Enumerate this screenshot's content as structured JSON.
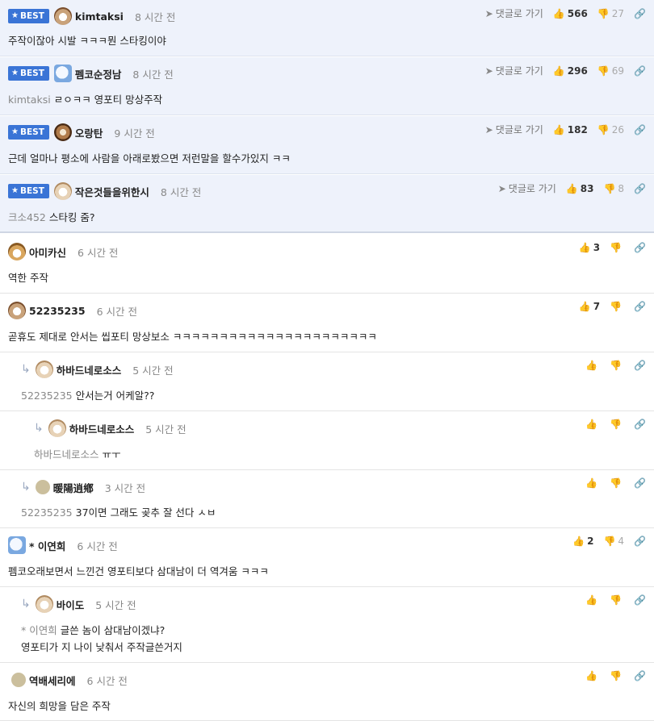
{
  "labels": {
    "best": "BEST",
    "goto_reply": "댓글로 가기"
  },
  "icons": {
    "star": "★",
    "plane": "➤",
    "thumb_up": "👍",
    "thumb_down": "👎",
    "link": "🔗",
    "reply_arrow": "↳"
  },
  "best_comments": [
    {
      "nick": "kimtaksi",
      "time": "8 시간 전",
      "text": "주작이잖아 시발 ㅋㅋㅋ뭔 스타킹이야",
      "mention": "",
      "up": "566",
      "down": "27"
    },
    {
      "nick": "펨코순정남",
      "time": "8 시간 전",
      "text": "ㄹㅇㅋㅋ 영포티 망상주작",
      "mention": "kimtaksi",
      "up": "296",
      "down": "69"
    },
    {
      "nick": "오랑탄",
      "time": "9 시간 전",
      "text": "근데 얼마나 평소에 사람을 아래로봤으면 저런말을 할수가있지 ㅋㅋ",
      "mention": "",
      "up": "182",
      "down": "26"
    },
    {
      "nick": "작은것들을위한시",
      "time": "8 시간 전",
      "text": "스타킹 줌?",
      "mention": "크소452",
      "up": "83",
      "down": "8"
    }
  ],
  "comments": [
    {
      "nick": "아미카신",
      "time": "6 시간 전",
      "text": "역한 주작",
      "mention": "",
      "up": "3",
      "down": ""
    },
    {
      "nick": "52235235",
      "time": "6 시간 전",
      "text": "곧휴도 제대로 안서는 씹포티 망상보소 ㅋㅋㅋㅋㅋㅋㅋㅋㅋㅋㅋㅋㅋㅋㅋㅋㅋㅋㅋㅋㅋㅋ",
      "mention": "",
      "up": "7",
      "down": ""
    },
    {
      "nick": "하바드네로소스",
      "time": "5 시간 전",
      "text": "안서는거 어케알??",
      "mention": "52235235",
      "up": "",
      "down": ""
    },
    {
      "nick": "하바드네로소스",
      "time": "5 시간 전",
      "text": "ㅠㅜ",
      "mention": "하바드네로소스",
      "up": "",
      "down": ""
    },
    {
      "nick": "暖陽逍鄕",
      "time": "3 시간 전",
      "text": "37이면 그래도 곶추 잘 선다 ㅅㅂ",
      "mention": "52235235",
      "up": "",
      "down": ""
    },
    {
      "nick": "* 이연희",
      "time": "6 시간 전",
      "text": "펨코오래보면서 느낀건 영포티보다 삼대남이 더 역겨움 ㅋㅋㅋ",
      "mention": "",
      "up": "2",
      "down": "4"
    },
    {
      "nick": "바이도",
      "time": "5 시간 전",
      "text": "글쓴 놈이 삼대남이겠냐?",
      "text2": "영포티가 지 나이 낮춰서 주작글쓴거지",
      "mention": "* 이연희",
      "up": "",
      "down": ""
    },
    {
      "nick": "역배세리에",
      "time": "6 시간 전",
      "text": "자신의 희망을 담은 주작",
      "mention": "",
      "up": "",
      "down": ""
    }
  ]
}
